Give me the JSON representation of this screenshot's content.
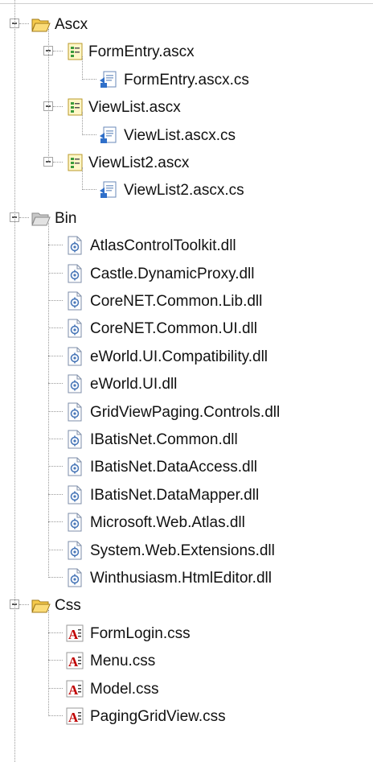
{
  "tree": {
    "folders": [
      {
        "label": "Ascx",
        "expanded": true,
        "children": [
          {
            "label": "FormEntry.ascx",
            "icon": "ascx-control-icon",
            "expanded": true,
            "children": [
              {
                "label": "FormEntry.ascx.cs",
                "icon": "cs-codefile-icon"
              }
            ]
          },
          {
            "label": "ViewList.ascx",
            "icon": "ascx-control-icon",
            "expanded": true,
            "children": [
              {
                "label": "ViewList.ascx.cs",
                "icon": "cs-codefile-icon"
              }
            ]
          },
          {
            "label": "ViewList2.ascx",
            "icon": "ascx-control-icon",
            "expanded": true,
            "children": [
              {
                "label": "ViewList2.ascx.cs",
                "icon": "cs-codefile-icon"
              }
            ]
          }
        ]
      },
      {
        "label": "Bin",
        "expanded": true,
        "children": [
          {
            "label": "AtlasControlToolkit.dll",
            "icon": "dll-file-icon"
          },
          {
            "label": "Castle.DynamicProxy.dll",
            "icon": "dll-file-icon"
          },
          {
            "label": "CoreNET.Common.Lib.dll",
            "icon": "dll-file-icon"
          },
          {
            "label": "CoreNET.Common.UI.dll",
            "icon": "dll-file-icon"
          },
          {
            "label": "eWorld.UI.Compatibility.dll",
            "icon": "dll-file-icon"
          },
          {
            "label": "eWorld.UI.dll",
            "icon": "dll-file-icon"
          },
          {
            "label": "GridViewPaging.Controls.dll",
            "icon": "dll-file-icon"
          },
          {
            "label": "IBatisNet.Common.dll",
            "icon": "dll-file-icon"
          },
          {
            "label": "IBatisNet.DataAccess.dll",
            "icon": "dll-file-icon"
          },
          {
            "label": "IBatisNet.DataMapper.dll",
            "icon": "dll-file-icon"
          },
          {
            "label": "Microsoft.Web.Atlas.dll",
            "icon": "dll-file-icon"
          },
          {
            "label": "System.Web.Extensions.dll",
            "icon": "dll-file-icon"
          },
          {
            "label": "Winthusiasm.HtmlEditor.dll",
            "icon": "dll-file-icon"
          }
        ]
      },
      {
        "label": "Css",
        "expanded": true,
        "children": [
          {
            "label": "FormLogin.css",
            "icon": "css-file-icon"
          },
          {
            "label": "Menu.css",
            "icon": "css-file-icon"
          },
          {
            "label": "Model.css",
            "icon": "css-file-icon"
          },
          {
            "label": "PagingGridView.css",
            "icon": "css-file-icon"
          }
        ]
      }
    ]
  },
  "colors": {
    "folder_open": "#f5c94a",
    "folder_closed": "#c8c8c8",
    "tree_line": "#9a9a9a",
    "css_letter": "#c00000",
    "cs_blue": "#2f6fc9"
  }
}
